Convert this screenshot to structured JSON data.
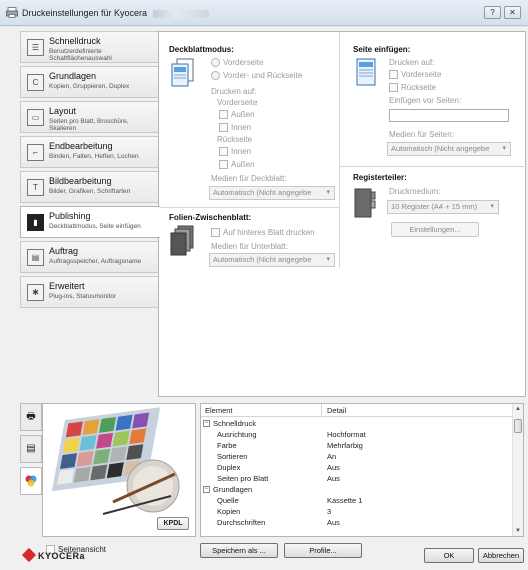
{
  "window": {
    "title": "Druckeinstellungen für Kyocera",
    "help_label": "?",
    "close_label": "✕"
  },
  "nav": {
    "items": [
      {
        "label": "Schnelldruck",
        "sub": "Benutzerdefinierte Schaltflächenauswahl",
        "icon": "quick-print-icon"
      },
      {
        "label": "Grundlagen",
        "sub": "Kopien, Gruppieren, Duplex",
        "icon": "basics-icon"
      },
      {
        "label": "Layout",
        "sub": "Seiten pro Blatt, Broschüre, Skalieren",
        "icon": "layout-icon"
      },
      {
        "label": "Endbearbeitung",
        "sub": "Binden, Falten, Heften, Lochen",
        "icon": "finishing-icon"
      },
      {
        "label": "Bildbearbeitung",
        "sub": "Bilder, Grafiken, Schriftarten",
        "icon": "imaging-icon"
      },
      {
        "label": "Publishing",
        "sub": "Deckblattmodus, Seite einfügen",
        "icon": "publishing-icon"
      },
      {
        "label": "Auftrag",
        "sub": "Auftragsspeicher, Auftragsname",
        "icon": "job-icon"
      },
      {
        "label": "Erweitert",
        "sub": "Plug-ins, Statusmonitor",
        "icon": "advanced-icon"
      }
    ],
    "active_index": 5
  },
  "cover": {
    "title": "Deckblattmodus:",
    "opt_front": "Vorderseite",
    "opt_both": "Vorder- und Rückseite",
    "print_on": "Drucken auf:",
    "front_label": "Vorderseite",
    "back_label": "Rückseite",
    "outside": "Außen",
    "inside": "Innen",
    "media_label": "Medien für Deckblatt:",
    "media_value": "Automatisch (Nicht angegebe"
  },
  "insert": {
    "title": "Seite einfügen:",
    "print_on": "Drucken auf:",
    "front": "Vorderseite",
    "back": "Rückseite",
    "insert_before": "Einfügen vor Seiten:",
    "media_label": "Medien für Seiten:",
    "media_value": "Automatisch (Nicht angegebe"
  },
  "foil": {
    "title": "Folien-Zwischenblatt:",
    "print_back": "Auf hinteres Blatt drucken",
    "media_label": "Medien für Unterblatt:",
    "media_value": "Automatisch (Nicht angegebe"
  },
  "tabs": {
    "title": "Registerteiler:",
    "media_label": "Druckmedium:",
    "media_value": "10 Register (A4 + 15 mm)",
    "settings_button": "Einstellungen..."
  },
  "summary": {
    "col_element": "Element",
    "col_detail": "Detail",
    "rows": [
      {
        "type": "group",
        "label": "Schnelldruck"
      },
      {
        "type": "item",
        "label": "Ausrichtung",
        "value": "Hochformat"
      },
      {
        "type": "item",
        "label": "Farbe",
        "value": "Mehrfarbig"
      },
      {
        "type": "item",
        "label": "Sortieren",
        "value": "An"
      },
      {
        "type": "item",
        "label": "Duplex",
        "value": "Aus"
      },
      {
        "type": "item",
        "label": "Seiten pro Blatt",
        "value": "Aus"
      },
      {
        "type": "group",
        "label": "Grundlagen"
      },
      {
        "type": "item",
        "label": "Quelle",
        "value": "Kassette 1"
      },
      {
        "type": "item",
        "label": "Kopien",
        "value": "3"
      },
      {
        "type": "item",
        "label": "Durchschriften",
        "value": "Aus"
      }
    ]
  },
  "preview": {
    "kpdl_label": "KPDL"
  },
  "bottom": {
    "page_view": "Seitenansicht",
    "save_as": "Speichern als ...",
    "profiles": "Profile...",
    "ok": "OK",
    "cancel": "Abbrechen",
    "brand": "KYOCERa"
  },
  "colors": {
    "brand_red": "#d7282f",
    "titlebar": "#dce5f0"
  }
}
